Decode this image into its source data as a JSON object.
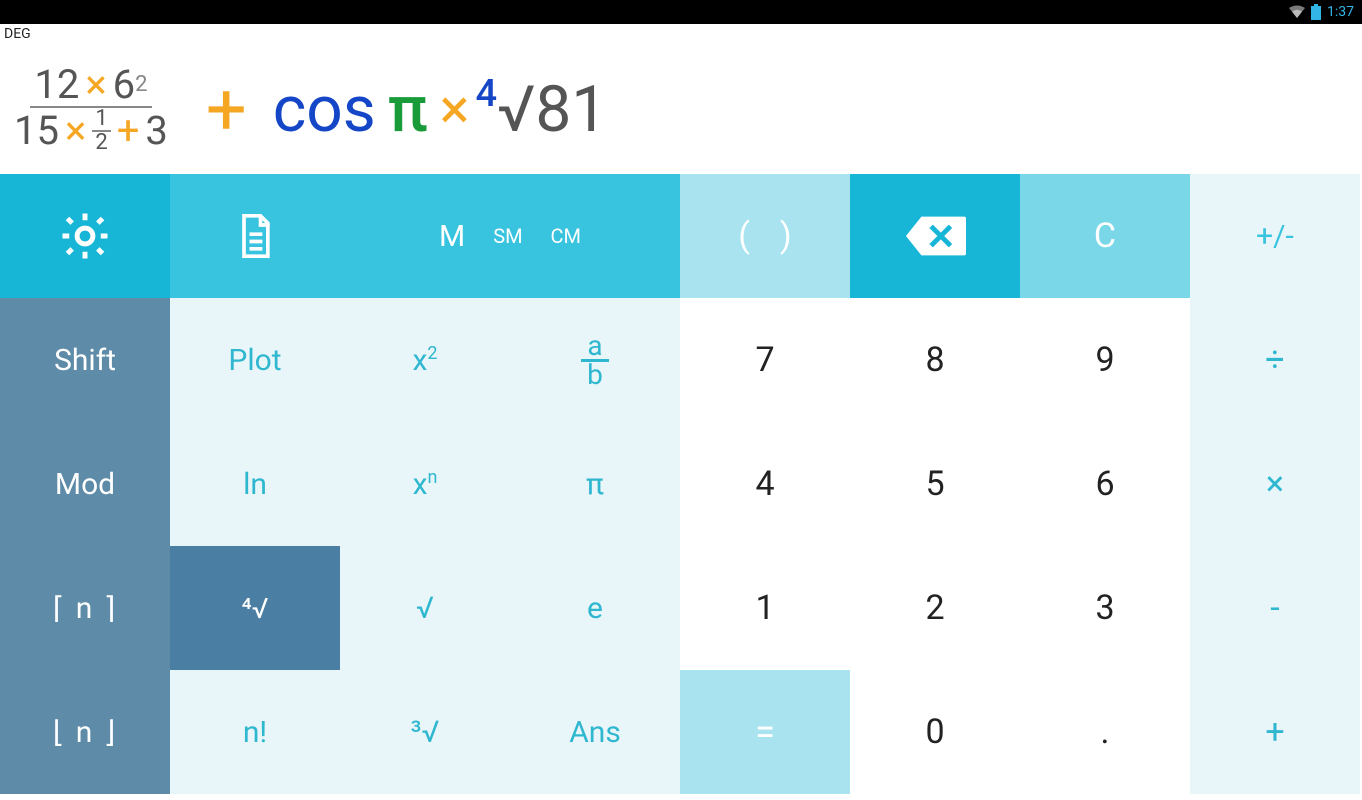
{
  "status": {
    "time": "1:37"
  },
  "mode": "DEG",
  "expression": {
    "frac": {
      "num_a": "12",
      "num_op": "×",
      "num_b": "6",
      "num_exp": "2",
      "den_a": "15",
      "den_op": "×",
      "den_frac_n": "1",
      "den_frac_d": "2",
      "den_plus": "+",
      "den_c": "3"
    },
    "plus": "+",
    "cos": "cos",
    "pi": "π",
    "mult": "×",
    "root_prefix": "4",
    "radical": "√",
    "radicand": "81"
  },
  "header": {
    "mem_M": "M",
    "mem_SM": "SM",
    "mem_CM": "CM",
    "paren_open": "(",
    "paren_close": ")",
    "clear": "C",
    "plusminus": "+/-"
  },
  "keys": {
    "shift": "Shift",
    "plot": "Plot",
    "xsq": "x²",
    "frac": {
      "a": "a",
      "b": "b"
    },
    "mod": "Mod",
    "ln": "ln",
    "xn": "xⁿ",
    "pi": "π",
    "ceil": "⌈ n ⌉",
    "nthroot": "⁴√",
    "sqrt": "√",
    "e": "e",
    "floor": "⌊ n ⌋",
    "fact": "n!",
    "cubert": "³√",
    "ans": "Ans",
    "n7": "7",
    "n8": "8",
    "n9": "9",
    "div": "÷",
    "n4": "4",
    "n5": "5",
    "n6": "6",
    "mul": "×",
    "n1": "1",
    "n2": "2",
    "n3": "3",
    "sub": "-",
    "eq": "=",
    "n0": "0",
    "dot": ".",
    "add": "+"
  }
}
